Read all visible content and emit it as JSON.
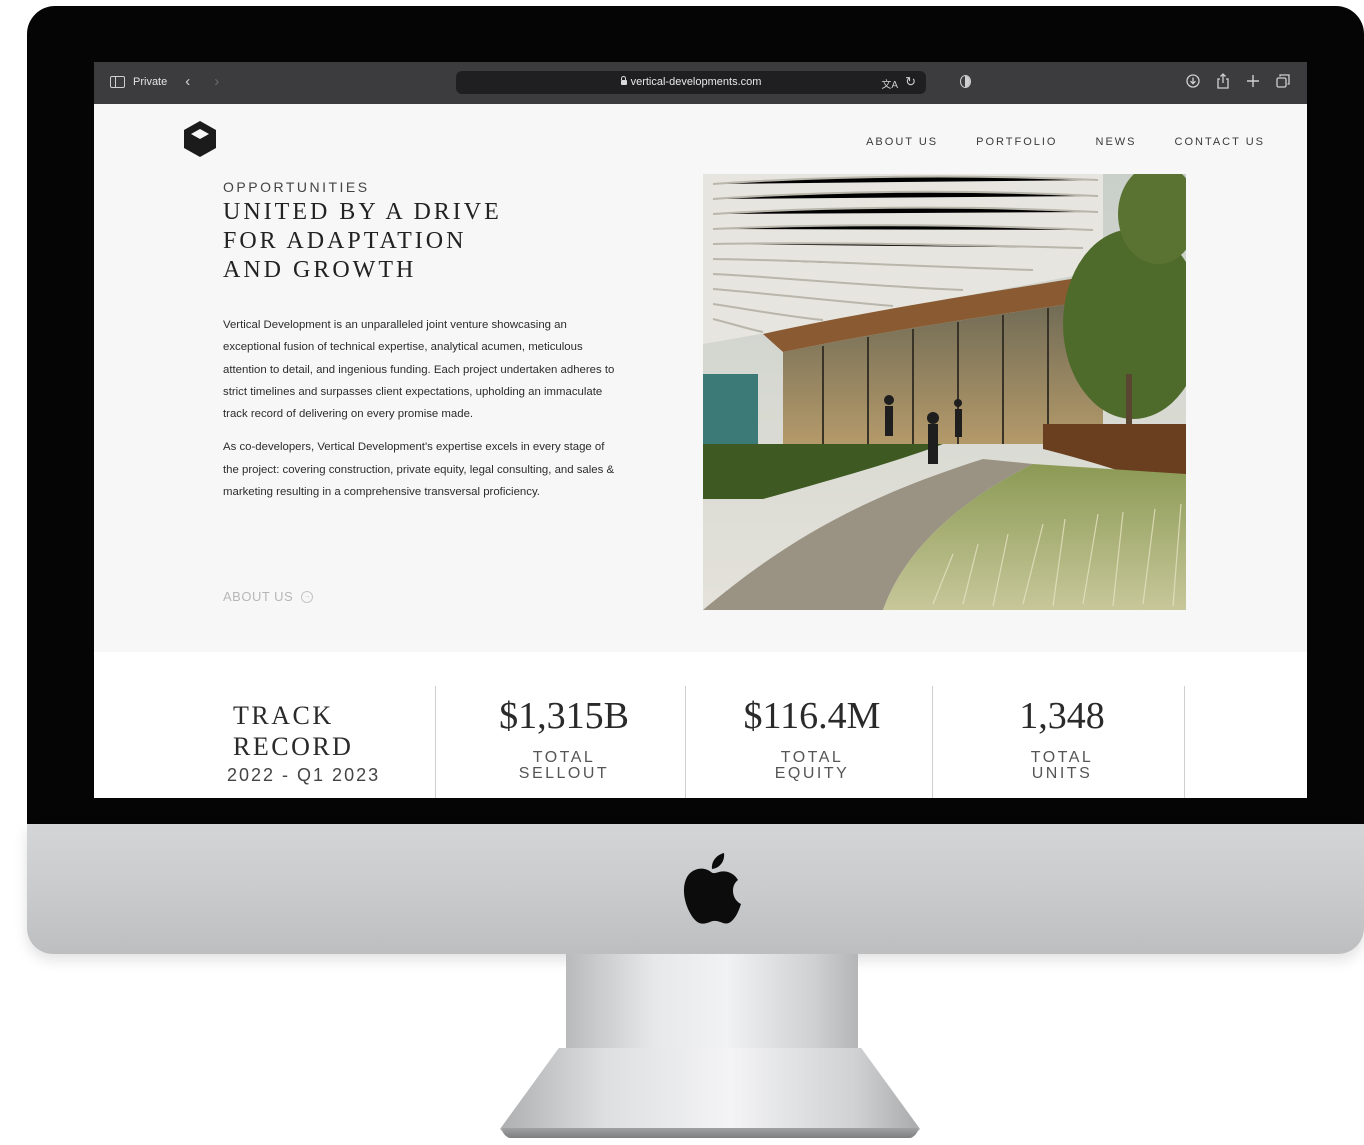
{
  "browser": {
    "mode_label": "Private",
    "url": "vertical-developments.com"
  },
  "nav": {
    "items": [
      "ABOUT US",
      "PORTFOLIO",
      "NEWS",
      "CONTACT US"
    ]
  },
  "hero": {
    "eyebrow": "OPPORTUNITIES",
    "headline_lines": [
      "UNITED BY A DRIVE",
      "FOR ADAPTATION",
      "AND GROWTH"
    ],
    "paragraph_1": "Vertical Development is an unparalleled joint venture showcasing an exceptional fusion of technical expertise, analytical acumen, meticulous attention to detail, and ingenious funding. Each project undertaken adheres to strict timelines and surpasses client expectations, upholding an immaculate track record of delivering on every promise made.",
    "paragraph_2": "As co-developers, Vertical Development's expertise excels in every stage of the project: covering construction, private equity, legal consulting, and sales & marketing resulting in a comprehensive transversal proficiency.",
    "cta_label": "ABOUT US"
  },
  "track_record": {
    "title_line_1": "TRACK",
    "title_line_2": "RECORD",
    "period": "2022 - Q1 2023",
    "stats": [
      {
        "value": "$1,315B",
        "label_line_1": "TOTAL",
        "label_line_2": "SELLOUT"
      },
      {
        "value": "$116.4M",
        "label_line_1": "TOTAL",
        "label_line_2": "EQUITY"
      },
      {
        "value": "1,348",
        "label_line_1": "TOTAL",
        "label_line_2": "UNITS"
      }
    ]
  },
  "icons": {
    "sidebar": "sidebar-icon",
    "back": "chevron-left-icon",
    "forward": "chevron-right-icon",
    "lock": "lock-icon",
    "translate": "translate-icon",
    "reload": "reload-icon",
    "privacy": "shield-icon",
    "download": "download-icon",
    "share": "share-icon",
    "new_tab": "plus-icon",
    "tabs": "tabs-overview-icon",
    "brand": "vertical-logo-icon",
    "device": "apple-logo-icon"
  },
  "colors": {
    "browser_toolbar": "#3c3c3e",
    "page_background": "#f7f7f7",
    "text_primary": "#222222",
    "muted_link": "#b7b7b7"
  }
}
